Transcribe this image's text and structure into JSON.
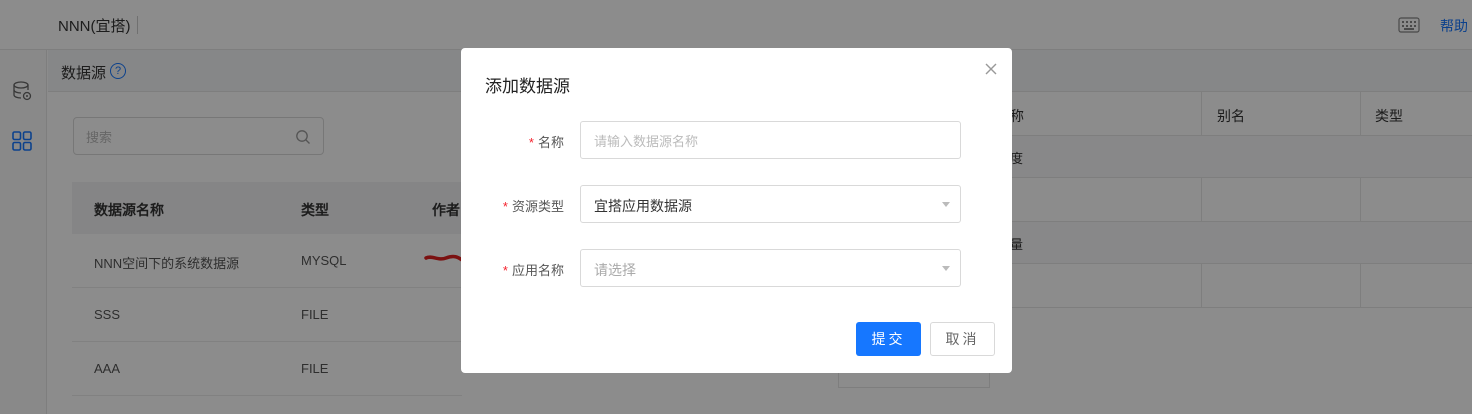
{
  "header": {
    "workspace_title": "NNN(宜搭)",
    "help_label": "帮助",
    "keyboard_icon": "keyboard-icon"
  },
  "left_rail": {
    "items": [
      {
        "icon": "database-icon"
      },
      {
        "icon": "grid-icon"
      }
    ]
  },
  "section": {
    "title": "数据源",
    "help_icon": "question-circle-icon"
  },
  "search": {
    "placeholder": "搜索",
    "value": ""
  },
  "datasource_table": {
    "columns": [
      "数据源名称",
      "类型",
      "作者"
    ],
    "rows": [
      {
        "name": "NNN空间下的系统数据源",
        "type": "MYSQL"
      },
      {
        "name": "SSS",
        "type": "FILE"
      },
      {
        "name": "AAA",
        "type": "FILE"
      }
    ]
  },
  "right_table": {
    "columns": [
      "称",
      "别名",
      "类型"
    ],
    "sections": [
      "度",
      "量"
    ]
  },
  "modal": {
    "title": "添加数据源",
    "fields": {
      "name": {
        "label": "名称",
        "placeholder": "请输入数据源名称",
        "value": ""
      },
      "resource_type": {
        "label": "资源类型",
        "selected": "宜搭应用数据源"
      },
      "app_name": {
        "label": "应用名称",
        "placeholder": "请选择"
      }
    },
    "submit_label": "提交",
    "cancel_label": "取消",
    "required_mark": "*"
  },
  "colors": {
    "primary": "#1677ff",
    "required": "#f5222d",
    "overlay": "rgba(0,0,0,0.45)"
  }
}
